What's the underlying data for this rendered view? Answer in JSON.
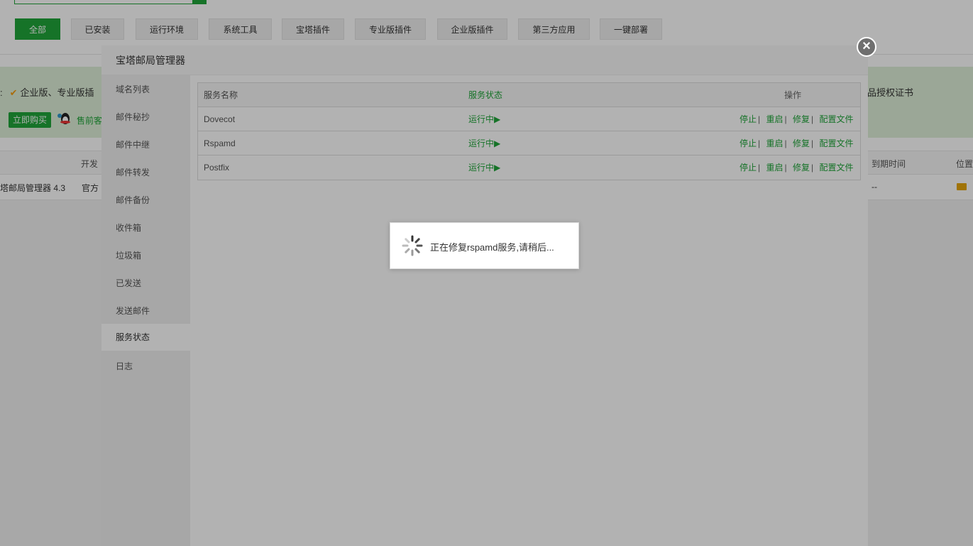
{
  "tabs": [
    "全部",
    "已安装",
    "运行环境",
    "系统工具",
    "宝塔插件",
    "专业版插件",
    "企业版插件",
    "第三方应用",
    "一键部署"
  ],
  "promo": {
    "text": "企业版、专业版插",
    "right_text": "品授权证书",
    "buy_label": "立即购买",
    "presale_label": "售前客"
  },
  "list": {
    "headers": {
      "developer": "开发",
      "expire": "到期时间",
      "location": "位置"
    },
    "row": {
      "name": "塔邮局管理器 4.3",
      "developer": "官方",
      "expire": "--"
    }
  },
  "modal": {
    "title": "宝塔邮局管理器",
    "sidebar": [
      "域名列表",
      "邮件秘抄",
      "邮件中继",
      "邮件转发",
      "邮件备份",
      "收件箱",
      "垃圾箱",
      "已发送",
      "发送邮件",
      "服务状态",
      "日志"
    ],
    "active_index": 9,
    "table": {
      "headers": {
        "name": "服务名称",
        "status": "服务状态",
        "ops": "操作"
      },
      "rows": [
        {
          "name": "Dovecot",
          "status": "运行中▶"
        },
        {
          "name": "Rspamd",
          "status": "运行中▶"
        },
        {
          "name": "Postfix",
          "status": "运行中▶"
        }
      ],
      "ops": [
        "停止",
        "重启",
        "修复",
        "配置文件"
      ]
    }
  },
  "loading": {
    "text": "正在修复rspamd服务,请稍后..."
  },
  "colors": {
    "accent": "#20a53a",
    "promo_bg": "#dff0d8"
  },
  "icons": {
    "close": "close-icon",
    "spinner": "spinner-icon",
    "folder": "folder-icon",
    "qq": "qq-icon"
  }
}
